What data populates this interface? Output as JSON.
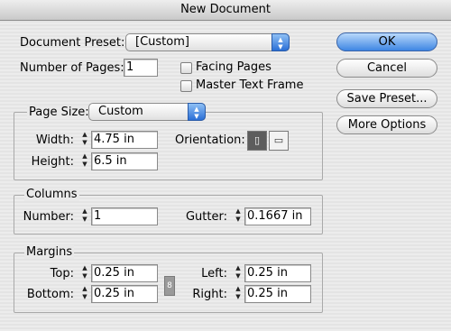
{
  "window": {
    "title": "New Document"
  },
  "preset": {
    "label": "Document Preset:",
    "value": "[Custom]"
  },
  "pages": {
    "label": "Number of Pages:",
    "value": "1"
  },
  "options": {
    "facing_pages": "Facing Pages",
    "master_text_frame": "Master Text Frame"
  },
  "buttons": {
    "ok": "OK",
    "cancel": "Cancel",
    "save_preset": "Save Preset...",
    "more_options": "More Options"
  },
  "page_size": {
    "label": "Page Size:",
    "value": "Custom",
    "width_label": "Width:",
    "width": "4.75 in",
    "height_label": "Height:",
    "height": "6.5 in",
    "orientation_label": "Orientation:"
  },
  "columns": {
    "title": "Columns",
    "number_label": "Number:",
    "number": "1",
    "gutter_label": "Gutter:",
    "gutter": "0.1667 in"
  },
  "margins": {
    "title": "Margins",
    "top_label": "Top:",
    "top": "0.25 in",
    "bottom_label": "Bottom:",
    "bottom": "0.25 in",
    "left_label": "Left:",
    "left": "0.25 in",
    "right_label": "Right:",
    "right": "0.25 in"
  }
}
